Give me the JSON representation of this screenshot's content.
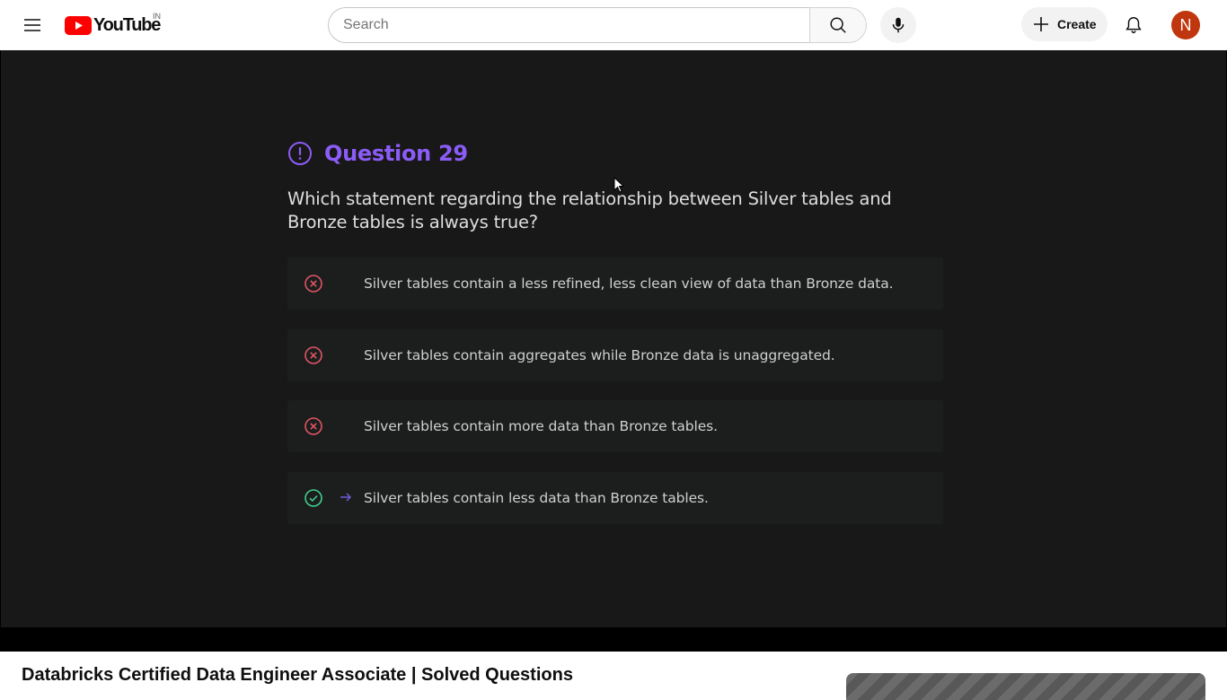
{
  "header": {
    "logo_text": "YouTube",
    "country_code": "IN",
    "search_placeholder": "Search",
    "create_label": "Create",
    "avatar_initial": "N",
    "icons": {
      "menu": "hamburger-menu-icon",
      "search": "search-icon",
      "mic": "microphone-icon",
      "create": "plus-icon",
      "notifications": "bell-icon"
    }
  },
  "video": {
    "question_title": "Question 29",
    "question_text": "Which statement regarding the relationship between Silver tables and Bronze tables is always true?",
    "options": [
      {
        "text": "Silver tables contain a less refined, less clean view of data than Bronze data.",
        "status": "incorrect"
      },
      {
        "text": "Silver tables contain aggregates while Bronze data is unaggregated.",
        "status": "incorrect"
      },
      {
        "text": "Silver tables contain more data than Bronze tables.",
        "status": "incorrect"
      },
      {
        "text": "Silver tables contain less data than Bronze tables.",
        "status": "correct"
      }
    ],
    "colors": {
      "accent": "#8b5cf6",
      "incorrect": "#e05565",
      "correct": "#3ecf8e",
      "arrow": "#6c5dd3"
    }
  },
  "video_title": "Databricks Certified Data Engineer Associate | Solved Questions"
}
